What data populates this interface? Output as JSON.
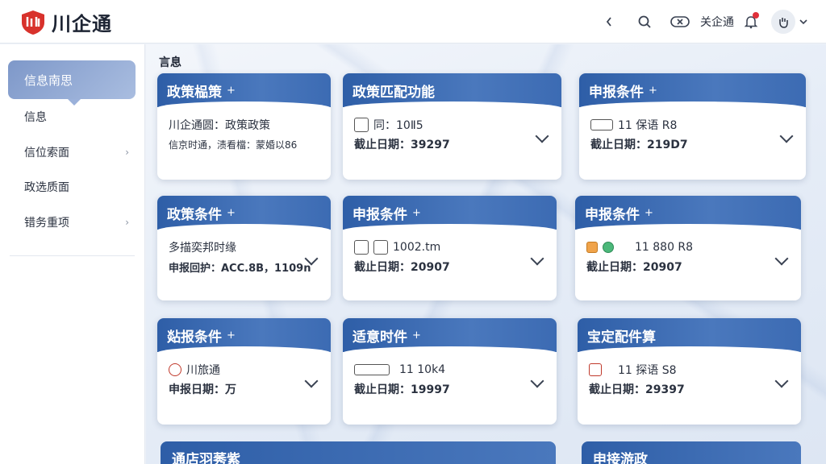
{
  "app": {
    "name": "川企通"
  },
  "topbar": {
    "back_icon": "chevron-left-icon",
    "search_icon": "search-icon",
    "close_icon": "close-circle-icon",
    "action_text": "关企通",
    "bell_icon": "bell-icon",
    "avatar_icon": "avatar-icon",
    "dropdown_icon": "chevron-down-icon"
  },
  "sidebar": {
    "active_item": "信息南思",
    "items": [
      {
        "label": "信息",
        "has_chevron": false
      },
      {
        "label": "信位索面",
        "has_chevron": true
      },
      {
        "label": "政选质面",
        "has_chevron": false
      },
      {
        "label": "错务重项",
        "has_chevron": true
      }
    ]
  },
  "main": {
    "section_title": "言息",
    "cards": [
      {
        "title": "政策榀策",
        "plus": "+",
        "line1": "川企通圆：政策政策",
        "line2": "信京时通，渍看檔：蒙婚以86"
      },
      {
        "title": "政策匹配功能",
        "plus": "",
        "line1": "同：10Ⅱ5",
        "line2": "截止日期：39297"
      },
      {
        "title": "申报条件",
        "plus": "+",
        "line1": "11 保语 R8",
        "line2": "截止日期：219D7"
      },
      {
        "title": "政策条件",
        "plus": "+",
        "line1": "多描奕邦时缘",
        "line2": "申报回护：ACC.8B，1109n"
      },
      {
        "title": "申报条件",
        "plus": "+",
        "line1": "1002.tm",
        "line2": "截止日期：20907"
      },
      {
        "title": "申报条件",
        "plus": "+",
        "line1": "11 880 R8",
        "line2": "截止日期：20907"
      },
      {
        "title": "煔报条件",
        "plus": "+",
        "line1": "川旅通",
        "line2": "申报日期：万"
      },
      {
        "title": "适意时件",
        "plus": "+",
        "line1": "11 10k4",
        "line2": "截止日期：19997"
      },
      {
        "title": "宝定配件算",
        "plus": "",
        "line1": "11 探语 S8",
        "line2": "截止日期：29397"
      }
    ],
    "bottom_left_title": "通店羽莠紫",
    "bottom_right_title": "申接游政"
  }
}
